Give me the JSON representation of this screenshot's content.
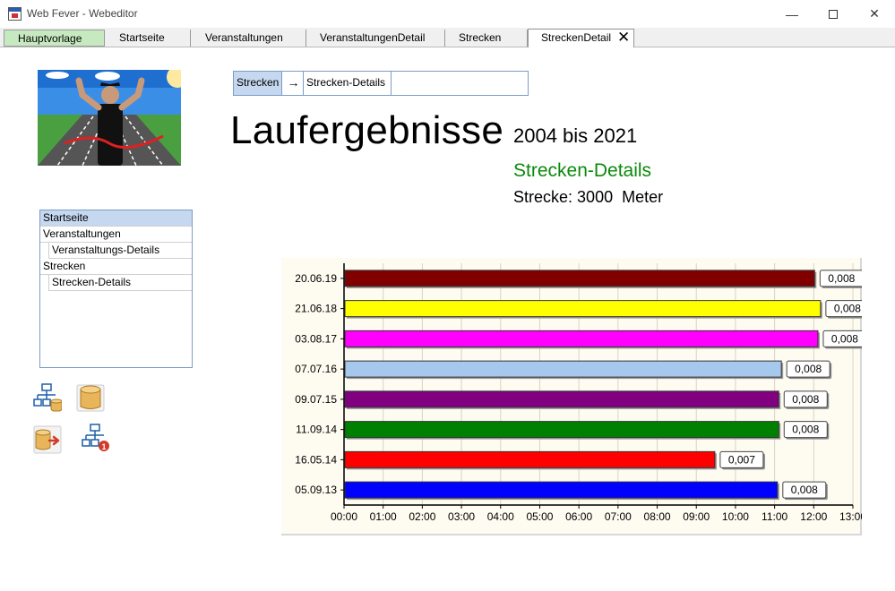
{
  "window": {
    "title": "Web Fever - Webeditor",
    "minimize_label": "—",
    "close_label": "✕"
  },
  "tabs": [
    {
      "label": "Hauptvorlage"
    },
    {
      "label": "Startseite"
    },
    {
      "label": "Veranstaltungen"
    },
    {
      "label": "VeranstaltungenDetail"
    },
    {
      "label": "Strecken"
    },
    {
      "label": "StreckenDetail"
    }
  ],
  "tab_close_label": "✕",
  "breadcrumb": {
    "item1": "Strecken",
    "arrow": "→",
    "item2": "Strecken-Details"
  },
  "page": {
    "title": "Laufergebnisse",
    "year_range": "2004 bis 2021",
    "subtitle": "Strecken-Details",
    "strecke_label": "Strecke:",
    "strecke_value": "3000",
    "strecke_unit": "Meter"
  },
  "nav": {
    "items": [
      {
        "label": "Startseite"
      },
      {
        "label": "Veranstaltungen"
      },
      {
        "label": "Veranstaltungs-Details"
      },
      {
        "label": "Strecken"
      },
      {
        "label": "Strecken-Details"
      }
    ]
  },
  "colors": {
    "accent_green": "#0a8a0a",
    "selection_blue": "#c6d7f0"
  },
  "icons": [
    "sitemap-database-icon",
    "database-icon",
    "database-export-icon",
    "sitemap-alert-icon"
  ],
  "chart_data": {
    "type": "bar",
    "orientation": "horizontal",
    "categories": [
      "20.06.19",
      "21.06.18",
      "03.08.17",
      "07.07.16",
      "09.07.15",
      "11.09.14",
      "16.05.14",
      "05.09.13"
    ],
    "values_minutes": [
      720,
      729,
      725,
      669,
      665,
      665,
      567,
      663
    ],
    "data_labels": [
      "0,008",
      "0,008",
      "0,008",
      "0,008",
      "0,008",
      "0,008",
      "0,007",
      "0,008"
    ],
    "bar_colors": [
      "#800000",
      "#ffff00",
      "#ff00ff",
      "#a6c8ec",
      "#800080",
      "#008000",
      "#ff0000",
      "#0000ff"
    ],
    "x_ticks": [
      "00:00",
      "01:00",
      "02:00",
      "03:00",
      "04:00",
      "05:00",
      "06:00",
      "07:00",
      "08:00",
      "09:00",
      "10:00",
      "11:00",
      "12:00",
      "13:00"
    ],
    "xlim_minutes": [
      0,
      780
    ],
    "grid": true
  }
}
